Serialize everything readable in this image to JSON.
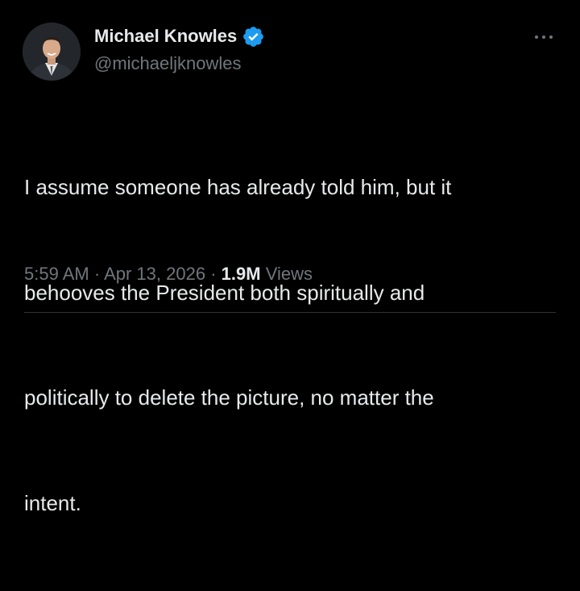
{
  "author": {
    "display_name": "Michael Knowles",
    "handle": "@michaeljknowles",
    "verified": true,
    "verified_icon": "verified-badge-icon",
    "avatar_icon": "avatar-photo"
  },
  "tweet": {
    "text_lines": [
      "I assume someone has already told him, but it",
      "behooves the President both spiritually and",
      "politically to delete the picture, no matter the",
      "intent."
    ]
  },
  "meta": {
    "time": "5:59 AM",
    "separator": "·",
    "date": "Apr 13, 2026",
    "views_count": "1.9M",
    "views_label": "Views"
  },
  "more_icon": "more-options-icon",
  "colors": {
    "background": "#000000",
    "primary_text": "#e7e9ea",
    "secondary_text": "#71767b",
    "verified_blue": "#1d9bf0",
    "divider": "#2f3336"
  }
}
